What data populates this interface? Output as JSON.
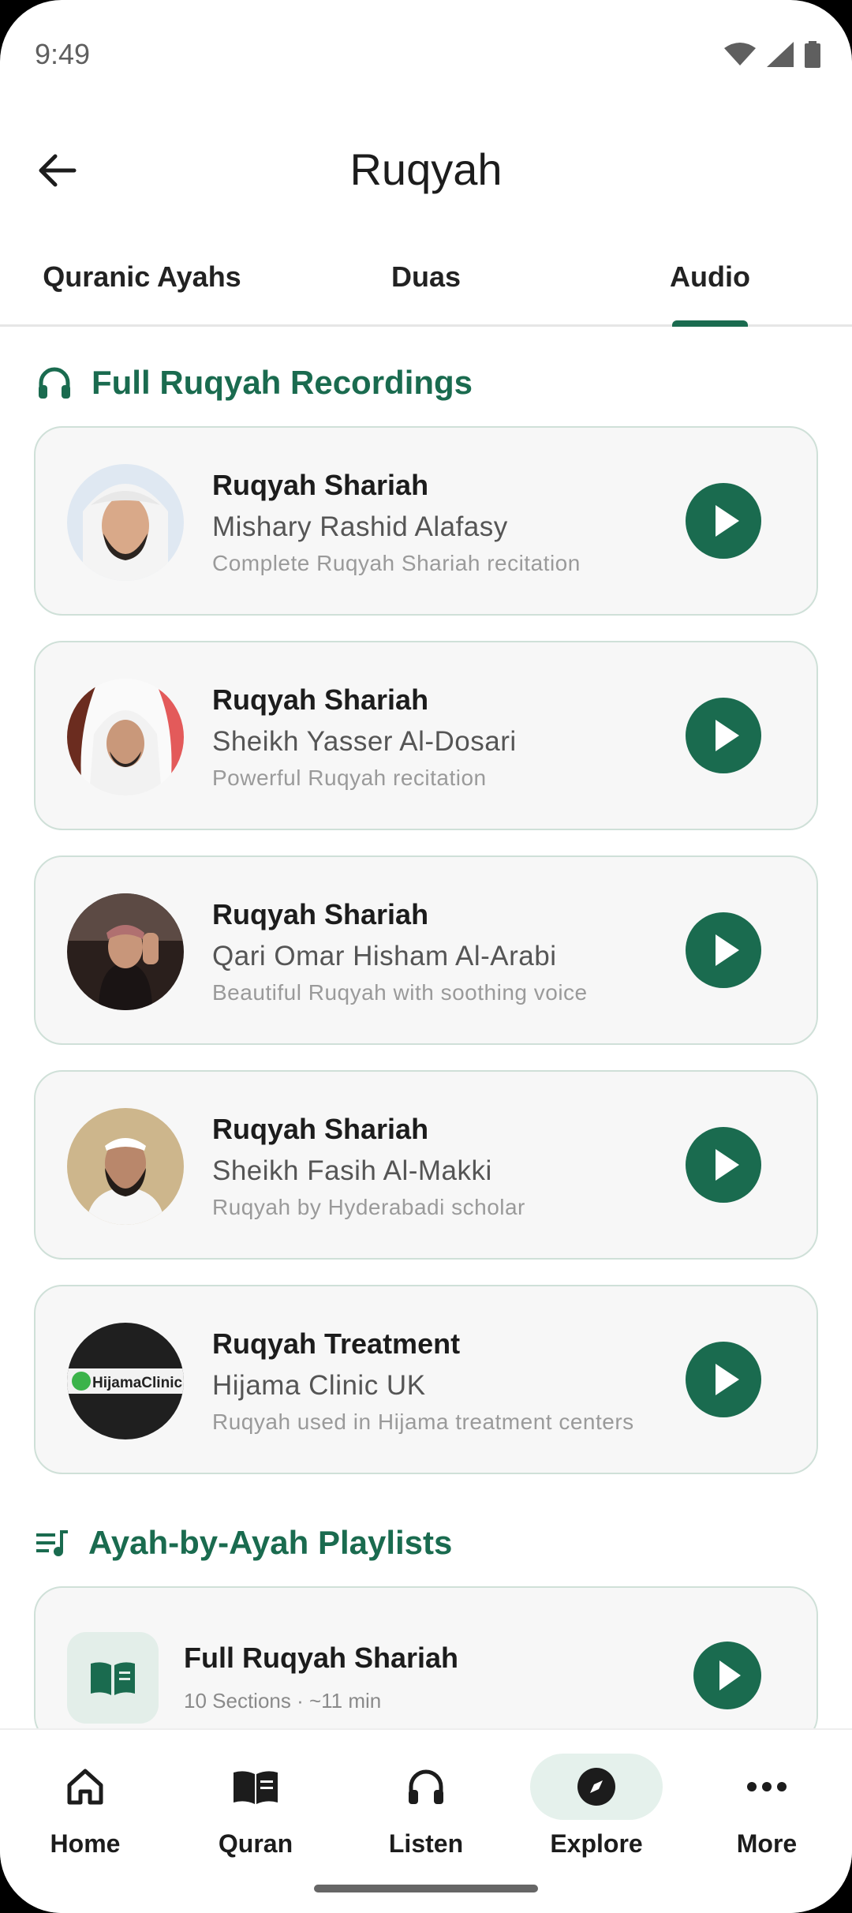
{
  "status": {
    "time": "9:49"
  },
  "appbar": {
    "title": "Ruqyah"
  },
  "tabs": [
    {
      "label": "Quranic Ayahs",
      "active": false
    },
    {
      "label": "Duas",
      "active": false
    },
    {
      "label": "Audio",
      "active": true
    }
  ],
  "sections": {
    "recordings_title": "Full Ruqyah Recordings",
    "playlists_title": "Ayah-by-Ayah Playlists"
  },
  "recordings": [
    {
      "title": "Ruqyah Shariah",
      "reciter": "Mishary Rashid Alafasy",
      "description": "Complete Ruqyah Shariah recitation"
    },
    {
      "title": "Ruqyah Shariah",
      "reciter": "Sheikh Yasser Al-Dosari",
      "description": "Powerful Ruqyah recitation"
    },
    {
      "title": "Ruqyah Shariah",
      "reciter": "Qari Omar Hisham Al-Arabi",
      "description": "Beautiful Ruqyah with soothing voice"
    },
    {
      "title": "Ruqyah Shariah",
      "reciter": "Sheikh Fasih Al-Makki",
      "description": "Ruqyah by Hyderabadi scholar"
    },
    {
      "title": "Ruqyah Treatment",
      "reciter": "Hijama Clinic UK",
      "description": "Ruqyah used in Hijama treatment centers",
      "logo_text": "HijamaClinic"
    }
  ],
  "playlists": [
    {
      "title": "Full Ruqyah Shariah",
      "meta": "10 Sections  ·  ~11 min"
    }
  ],
  "nav": [
    {
      "label": "Home",
      "icon": "home-icon"
    },
    {
      "label": "Quran",
      "icon": "book-icon"
    },
    {
      "label": "Listen",
      "icon": "headphones-icon"
    },
    {
      "label": "Explore",
      "icon": "compass-icon",
      "active": true
    },
    {
      "label": "More",
      "icon": "more-icon"
    }
  ],
  "colors": {
    "accent": "#1a6b4f",
    "card_bg": "#f7f7f7",
    "card_border": "#cfe0d8"
  }
}
